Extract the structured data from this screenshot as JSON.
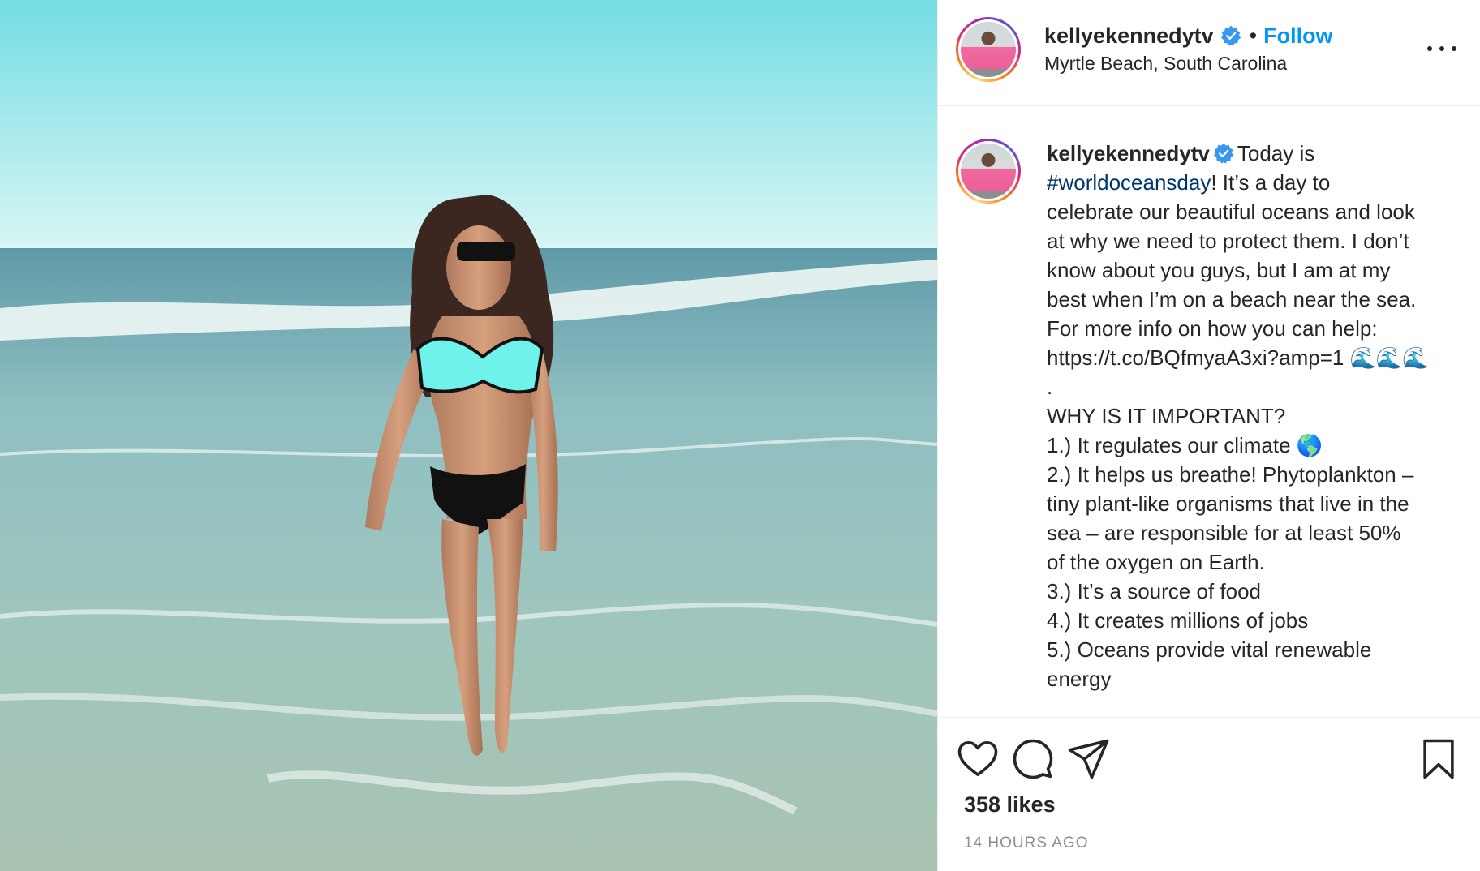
{
  "post": {
    "username": "kellyekennedytv",
    "follow_label": "Follow",
    "separator": "•",
    "location": "Myrtle Beach, South Carolina",
    "caption_lines": [
      "Today is",
      "#worldoceansday",
      "! It’s a day to",
      "celebrate our beautiful oceans and look",
      "at why we need to protect them. I don’t",
      "know about you guys, but I am at my",
      "best when I’m on a beach near the sea.",
      "For more info on how you can help:",
      "https://t.co/BQfmyaA3xi?amp=1 🌊🌊🌊",
      ".",
      "WHY IS IT IMPORTANT?",
      "1.) It regulates our climate 🌎",
      "2.) It helps us breathe! Phytoplankton –",
      "tiny plant-like organisms that live in the",
      "sea – are responsible for at least 50%",
      "of the oxygen on Earth.",
      "3.) It’s a source of food",
      "4.) It creates millions of jobs",
      "5.) Oceans provide vital renewable",
      "energy"
    ],
    "likes": "358 likes",
    "timestamp": "14 HOURS AGO"
  },
  "colors": {
    "accent": "#0095f6",
    "hashtag": "#00376b",
    "verified": "#3897f0",
    "muted": "#8e8e8e"
  },
  "icons": [
    "verified-badge-icon",
    "more-options-icon",
    "heart-icon",
    "comment-icon",
    "share-icon",
    "bookmark-icon"
  ]
}
